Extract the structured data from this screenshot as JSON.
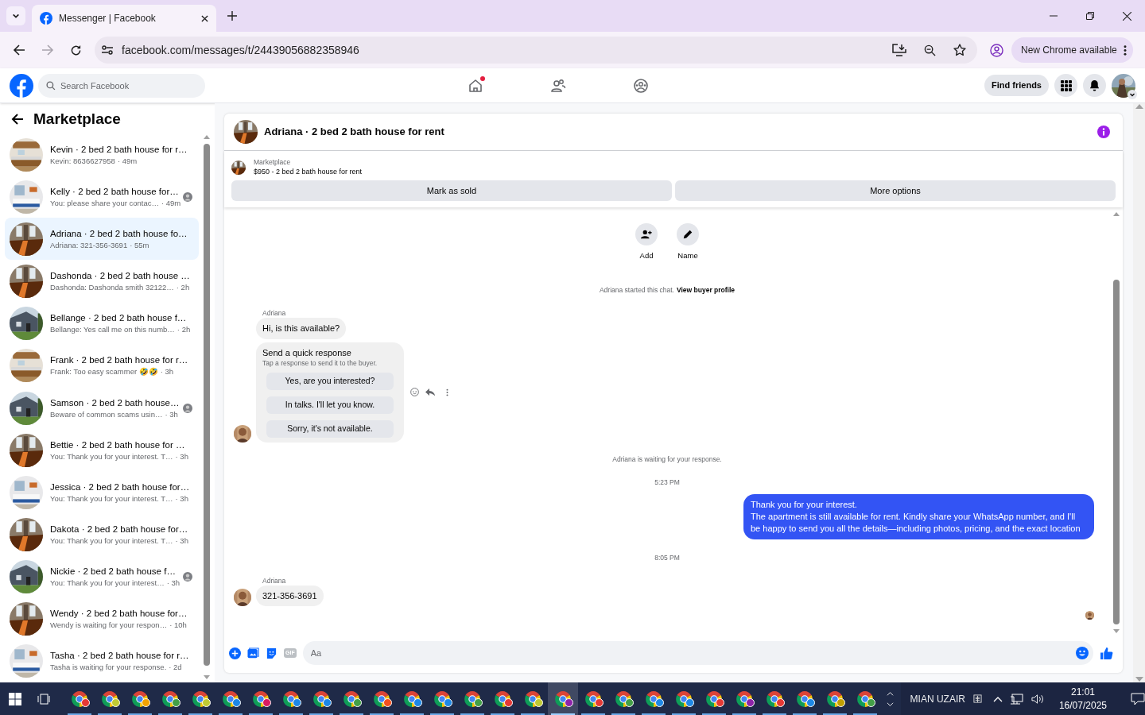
{
  "browser": {
    "tab_title": "Messenger | Facebook",
    "url": "facebook.com/messages/t/24439056882358946",
    "update_button": "New Chrome available"
  },
  "fb_nav": {
    "search_placeholder": "Search Facebook",
    "nav_items": [
      {
        "kind": "home",
        "notification": true
      },
      {
        "kind": "friends",
        "notification": false
      },
      {
        "kind": "groups",
        "notification": false
      }
    ],
    "find_friends": "Find friends"
  },
  "sidebar": {
    "title": "Marketplace",
    "conversations": [
      {
        "title": "Kevin · 2 bed 2 bath house for r…",
        "preview": "Kevin: 8636627958",
        "time": "· 49m",
        "seen": false,
        "selected": false
      },
      {
        "title": "Kelly · 2 bed 2 bath house for…",
        "preview": "You: please share your contac…",
        "time": "· 49m",
        "seen": true,
        "selected": false
      },
      {
        "title": "Adriana · 2 bed 2 bath house fo…",
        "preview": "Adriana: 321-356-3691",
        "time": "· 55m",
        "seen": false,
        "selected": true
      },
      {
        "title": "Dashonda · 2 bed 2 bath house …",
        "preview": "Dashonda: Dashonda smith 32122…",
        "time": "· 2h",
        "seen": false,
        "selected": false
      },
      {
        "title": "Bellange · 2 bed 2 bath house f…",
        "preview": "Bellange: Yes call me on this numb…",
        "time": "· 2h",
        "seen": false,
        "selected": false
      },
      {
        "title": "Frank · 2 bed 2 bath house for r…",
        "preview": "Frank: Too easy scammer 🤣🤣",
        "time": "· 3h",
        "seen": false,
        "selected": false
      },
      {
        "title": "Samson · 2 bed 2 bath house…",
        "preview": "Beware of common scams usin…",
        "time": "· 3h",
        "seen": true,
        "selected": false
      },
      {
        "title": "Bettie · 2 bed 2 bath house for …",
        "preview": "You: Thank you for your interest. T…",
        "time": "· 3h",
        "seen": false,
        "selected": false
      },
      {
        "title": "Jessica · 2 bed 2 bath house for…",
        "preview": "You: Thank you for your interest. T…",
        "time": "· 3h",
        "seen": false,
        "selected": false
      },
      {
        "title": "Dakota · 2 bed 2 bath house for…",
        "preview": "You: Thank you for your interest. T…",
        "time": "· 3h",
        "seen": false,
        "selected": false
      },
      {
        "title": "Nickie · 2 bed 2 bath house f…",
        "preview": "You: Thank you for your interest…",
        "time": "· 3h",
        "seen": true,
        "selected": false
      },
      {
        "title": "Wendy · 2 bed 2 bath house for…",
        "preview": "Wendy is waiting for your respon…",
        "time": "· 10h",
        "seen": false,
        "selected": false
      },
      {
        "title": "Tasha · 2 bed 2 bath house for r…",
        "preview": "Tasha is waiting for your response.",
        "time": "· 2d",
        "seen": false,
        "selected": false
      }
    ]
  },
  "chat": {
    "title": "Adriana · 2 bed 2 bath house for rent",
    "listing": {
      "label": "Marketplace",
      "title": "$950 - 2 bed 2 bath house for rent"
    },
    "actions": [
      "Mark as sold",
      "More options"
    ],
    "events": [
      {
        "kind": "profile_actions",
        "items": [
          {
            "kind": "add",
            "label": "Add"
          },
          {
            "kind": "name",
            "label": "Name"
          }
        ]
      },
      {
        "kind": "notice",
        "text": "Adriana started this chat.",
        "link": "View buyer profile"
      },
      {
        "kind": "incoming",
        "sender": "Adriana",
        "bubbles": [
          {
            "kind": "text",
            "text": "Hi, is this available?"
          },
          {
            "kind": "quick_response",
            "title": "Send a quick response",
            "hint": "Tap a response to send it to the buyer.",
            "options": [
              "Yes, are you interested?",
              "In talks. I'll let you know.",
              "Sorry, it's not available."
            ]
          }
        ]
      },
      {
        "kind": "notice",
        "text": "Adriana is waiting for your response."
      },
      {
        "kind": "time",
        "text": "5:23 PM"
      },
      {
        "kind": "outgoing",
        "lines": [
          "Thank you for your interest.",
          "The apartment is still available for rent. Kindly share your WhatsApp number, and I'll be happy to send you all the details—including photos, pricing, and the exact location"
        ]
      },
      {
        "kind": "time",
        "text": "8:05 PM"
      },
      {
        "kind": "incoming",
        "sender": "Adriana",
        "bubbles": [
          {
            "kind": "text",
            "text": "321-356-3691"
          }
        ]
      },
      {
        "kind": "seen"
      }
    ],
    "composer": {
      "gif_label": "GIF",
      "placeholder": "Aa"
    }
  },
  "taskbar": {
    "apps": [
      {
        "color": "#e53935",
        "selected": false
      },
      {
        "color": "#c0ca33",
        "selected": false
      },
      {
        "color": "#f4a300",
        "selected": false
      },
      {
        "color": "#43a047",
        "selected": false
      },
      {
        "color": "#c0ca33",
        "selected": false
      },
      {
        "color": "#1e88e5",
        "selected": false
      },
      {
        "color": "#d81b60",
        "selected": false
      },
      {
        "color": "#1e88e5",
        "selected": false
      },
      {
        "color": "#1e88e5",
        "selected": false
      },
      {
        "color": "#43a047",
        "selected": false
      },
      {
        "color": "#f4511e",
        "selected": false
      },
      {
        "color": "#1e88e5",
        "selected": false
      },
      {
        "color": "#1e88e5",
        "selected": false
      },
      {
        "color": "#43a047",
        "selected": false
      },
      {
        "color": "#e53935",
        "selected": false
      },
      {
        "color": "#c0ca33",
        "selected": false
      },
      {
        "color": "#8e24aa",
        "selected": true
      },
      {
        "color": "#e53935",
        "selected": false
      },
      {
        "color": "#43a047",
        "selected": false
      },
      {
        "color": "#1e88e5",
        "selected": false
      },
      {
        "color": "#1e88e5",
        "selected": false
      },
      {
        "color": "#e53935",
        "selected": false
      },
      {
        "color": "#8e24aa",
        "selected": false
      },
      {
        "color": "#e53935",
        "selected": false
      },
      {
        "color": "#1e88e5",
        "selected": false
      },
      {
        "color": "#c0a000",
        "selected": false
      },
      {
        "color": "#43a047",
        "selected": false
      }
    ],
    "user": "MIAN UZAIR",
    "time": "21:01",
    "date": "16/07/2025"
  }
}
